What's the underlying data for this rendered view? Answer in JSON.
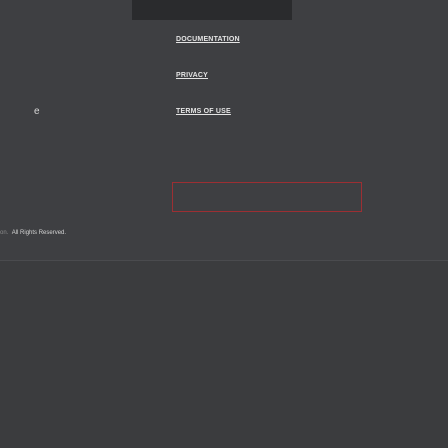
{
  "footer": {
    "nav": {
      "documentation": "DOCUMENTATION",
      "privacy": "PRIVACY",
      "terms": "TERMS OF USE"
    },
    "left_glyph": "e",
    "copyright_prefix": "on.",
    "copyright_text": "All Rights Reserved."
  }
}
